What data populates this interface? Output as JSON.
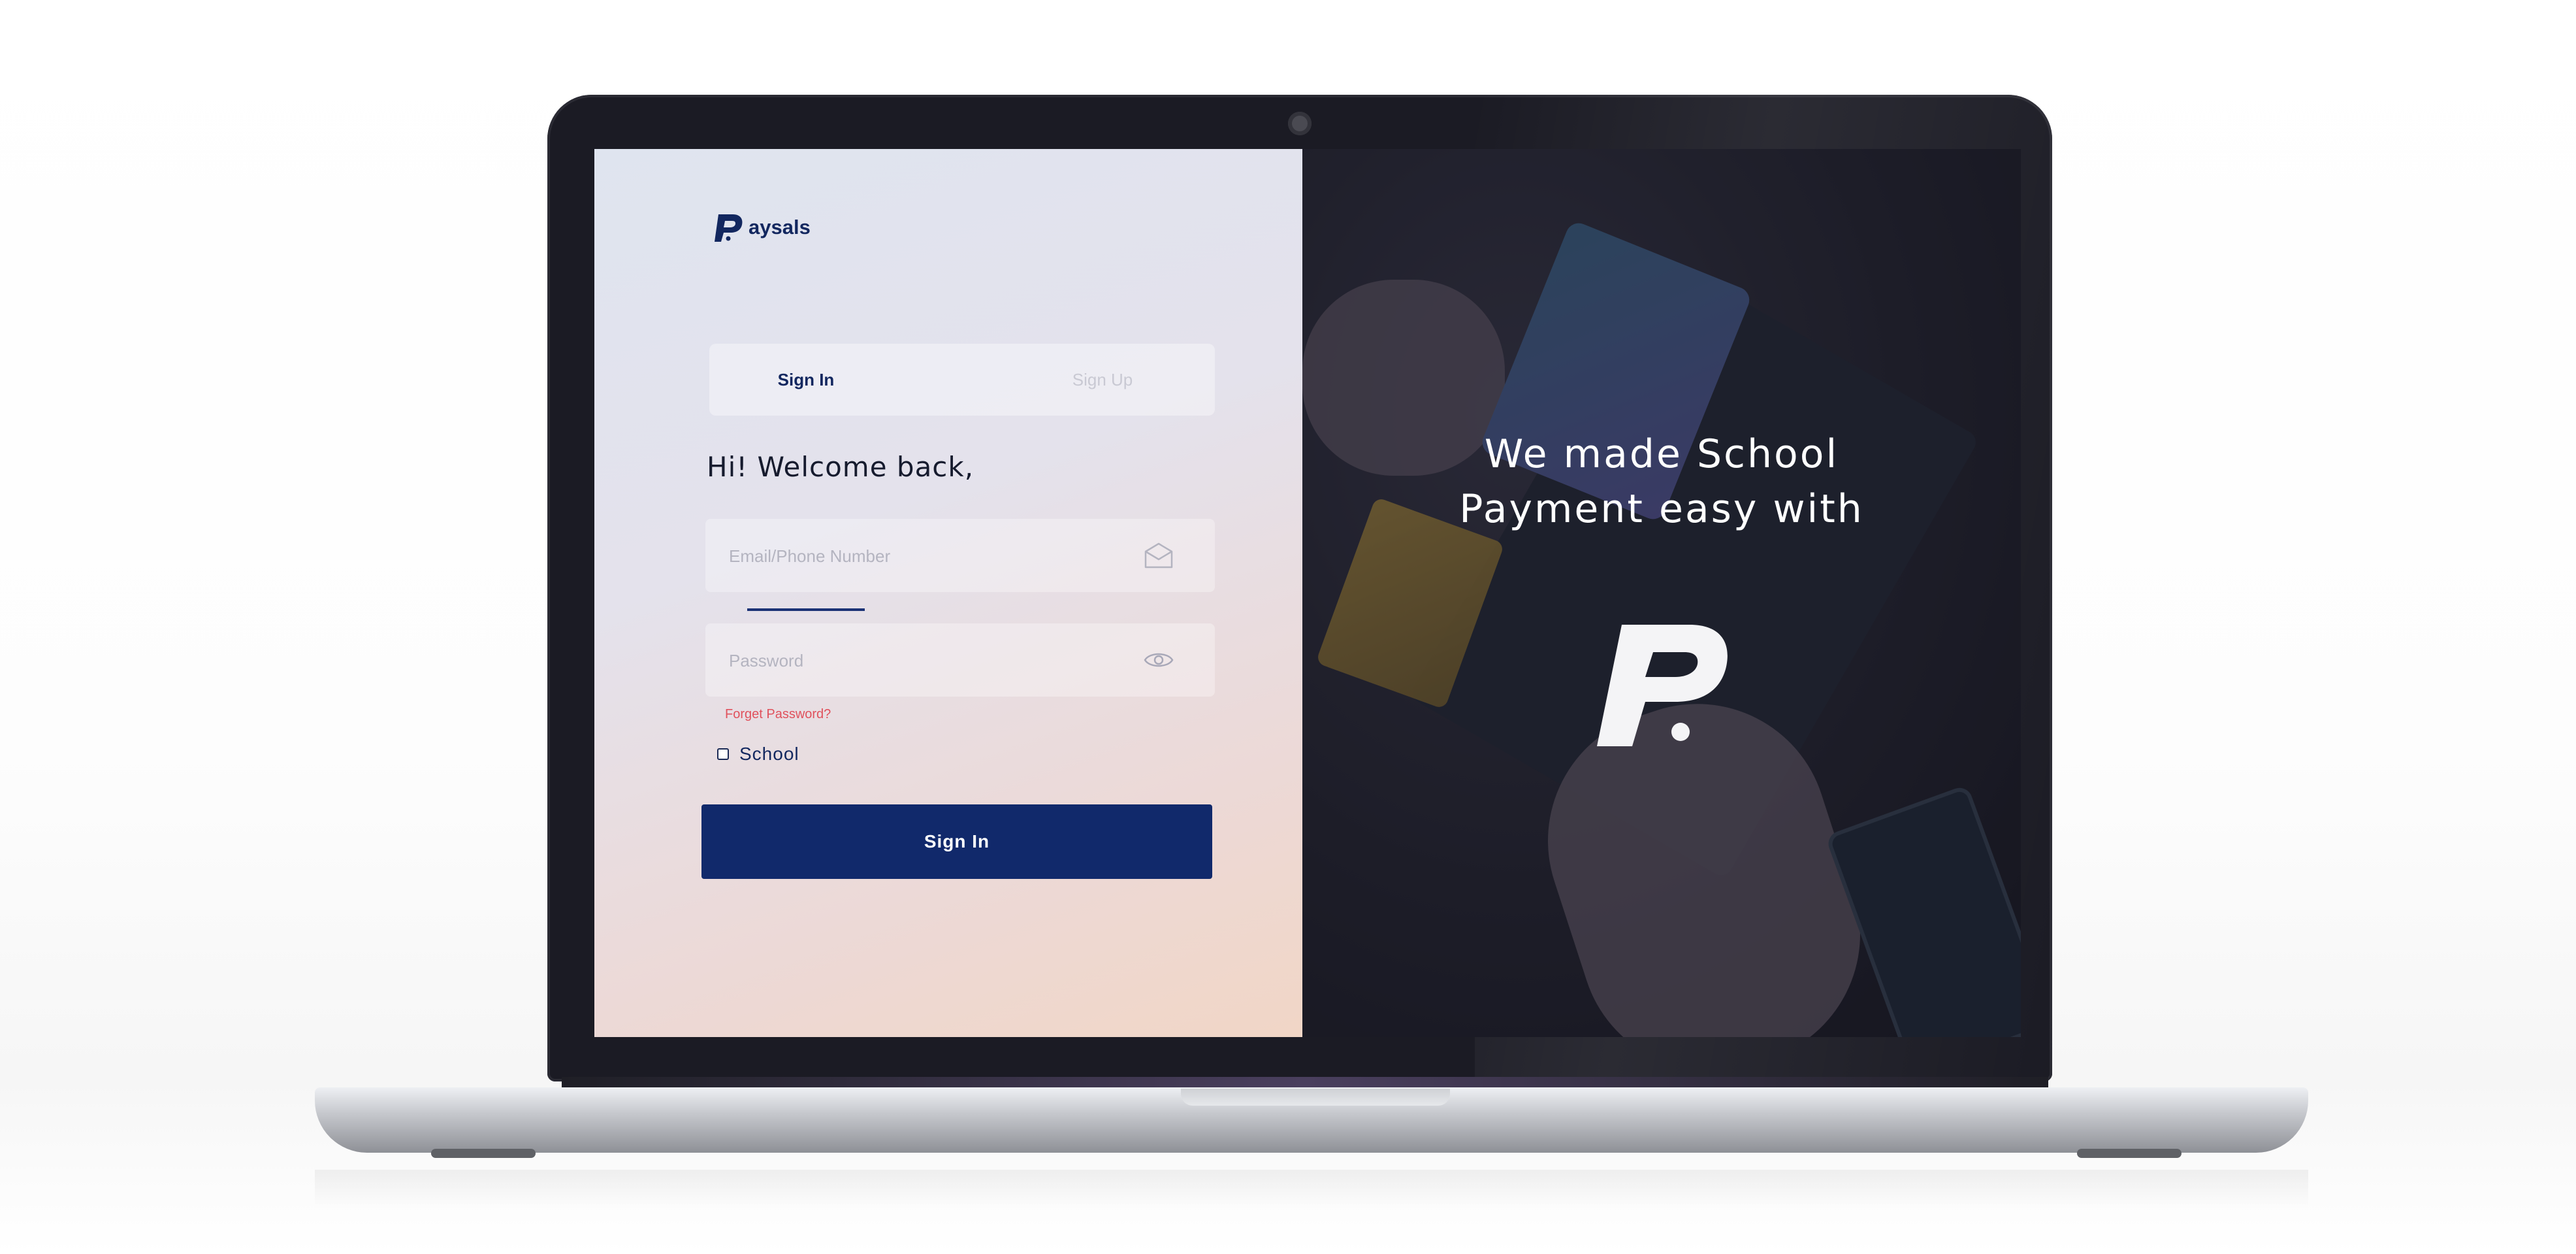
{
  "brand": {
    "name": "aysals",
    "logo_icon": "paysals-p-logo-icon"
  },
  "auth": {
    "tabs": [
      {
        "label": "Sign In",
        "active": true
      },
      {
        "label": "Sign Up",
        "active": false
      }
    ],
    "greeting": "Hi! Welcome back,",
    "email": {
      "placeholder": "Email/Phone Number",
      "icon": "envelope-icon"
    },
    "password": {
      "placeholder": "Password",
      "icon": "eye-icon"
    },
    "forgot_label": "Forget Password?",
    "school_checkbox": {
      "label": "School",
      "checked": false
    },
    "submit_label": "Sign In"
  },
  "hero": {
    "tagline_line1": "We made School",
    "tagline_line2": "Payment easy with",
    "logo_icon": "paysals-p-logo-icon"
  },
  "colors": {
    "primary": "#11296b",
    "brand_text": "#12275f",
    "link_error": "#e0515c",
    "hero_overlay": "#1f1f29"
  }
}
